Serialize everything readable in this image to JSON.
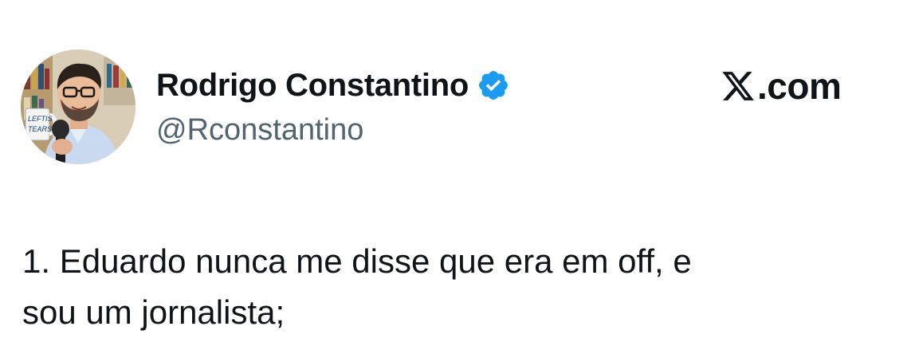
{
  "author": {
    "display_name": "Rodrigo Constantino",
    "handle": "@Rconstantino",
    "verified": true,
    "verified_color": "#1d9bf0"
  },
  "avatar": {
    "mug_text_line1": "LEFTIS",
    "mug_text_line2": "TEARS"
  },
  "brand": {
    "icon": "x-logo-icon",
    "text": ".com"
  },
  "tweet": {
    "lines": [
      "1. Eduardo nunca me disse que era em off, e",
      "sou um jornalista;"
    ]
  },
  "colors": {
    "text_primary": "#0f1419",
    "text_secondary": "#536471",
    "background": "#ffffff"
  }
}
